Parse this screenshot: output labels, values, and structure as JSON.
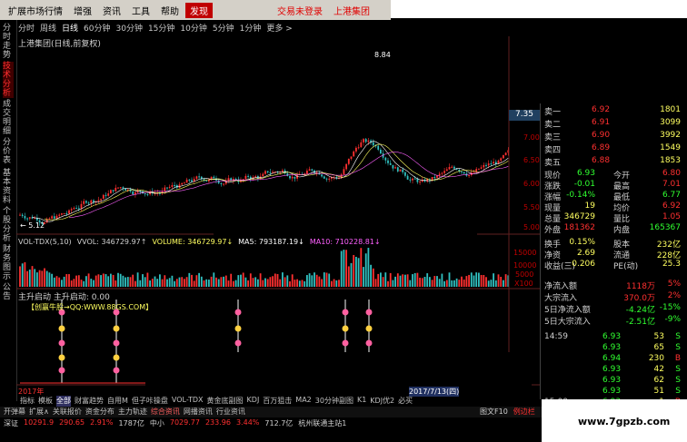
{
  "menubar": {
    "items": [
      "扩展市场行情",
      "增强",
      "资讯",
      "工具",
      "帮助"
    ],
    "active_item": "发现",
    "trade_status": "交易未登录",
    "stock_code_link": "上港集团"
  },
  "periods": [
    "分时",
    "周线",
    "日线",
    "60分钟",
    "30分钟",
    "15分钟",
    "10分钟",
    "5分钟",
    "1分钟",
    "更多 >"
  ],
  "selected_period": "日线",
  "chart_title": "上港集团(日线,前复权)",
  "left_tabs": [
    {
      "label": "分时走势",
      "active": false
    },
    {
      "label": "技术分析",
      "active": true
    },
    {
      "label": "成交明细",
      "active": false
    },
    {
      "label": "分价表",
      "active": false
    },
    {
      "label": "基本资料",
      "active": false
    },
    {
      "label": "个股分析",
      "active": false
    },
    {
      "label": "财务图示",
      "active": false
    },
    {
      "label": "公告",
      "active": false
    }
  ],
  "price_axis": {
    "labels": [
      "8.84",
      "7.00",
      "6.50",
      "6.00",
      "5.50",
      "5.00"
    ],
    "current_price_badge": "7.35",
    "low_marker": "← 5.12",
    "high_marker": "8.84"
  },
  "volume_header": {
    "name": "VOL-TDX(5,10)",
    "vvol": "VVOL: 346729.97↑",
    "volume": "VOLUME: 346729.97↓",
    "ma5": "MA5: 793187.19↓",
    "ma10": "MA10: 710228.81↓"
  },
  "volume_axis": [
    "15000",
    "10000",
    "5000",
    "X100"
  ],
  "indicator_header": "主升启动  主升启动: 0.00",
  "indicator_watermark": "【创赢牛股→QQ:WWW.88GS.COM】",
  "date_label": "2017年",
  "date_label_right": "2017/7/13(四)",
  "bottom_tabs": [
    "指标",
    "模板",
    "全部",
    "财富趋势",
    "自用M",
    "但子咔操盘",
    "VOL-TDX",
    "黄金底副图",
    "KDJ",
    "百万狙击",
    "MA2",
    "30分钟副图",
    "K1",
    "KDJ优2",
    "必买"
  ],
  "selected_bottom_tab": "全部",
  "bottom_tabs2": [
    "开弹幕",
    "扩展∧",
    "关联报价",
    "资金分布",
    "主力轨迹",
    "综合资讯",
    "网播资讯",
    "行业资讯"
  ],
  "selected_bottom_tab2": "综合资讯",
  "status": {
    "sh_label": "深证",
    "sh_value": "10291.9",
    "sh_change": "290.65",
    "sh_pct": "2.91%",
    "sh_amount": "1787亿",
    "mid_label": "中小",
    "mid_value": "7029.77",
    "mid_change": "233.96",
    "mid_pct": "3.44%",
    "mid_amount": "712.7亿",
    "network": "杭州联通主站1"
  },
  "right_panel_tabs": [
    "图文F10",
    "例边栏"
  ],
  "order_book": {
    "asks": [
      {
        "label": "卖一",
        "price": "6.92",
        "vol": "1801"
      },
      {
        "label": "卖二",
        "price": "6.91",
        "vol": "3099"
      },
      {
        "label": "卖三",
        "price": "6.90",
        "vol": "3992"
      },
      {
        "label": "卖四",
        "price": "6.89",
        "vol": "1549"
      },
      {
        "label": "卖五",
        "price": "6.88",
        "vol": "1853"
      }
    ]
  },
  "quote": {
    "now_label": "现价",
    "now": "6.93",
    "open_label": "今开",
    "open": "6.80",
    "chg_label": "涨跌",
    "chg": "-0.01",
    "high_label": "最高",
    "high": "7.01",
    "pct_label": "涨幅",
    "pct": "-0.14%",
    "low_label": "最低",
    "low": "6.77",
    "vol_now_label": "现量",
    "vol_now": "19",
    "avg_label": "均价",
    "avg": "6.92",
    "total_label": "总量",
    "total": "346729",
    "ratio_label": "量比",
    "ratio": "1.05",
    "out_label": "外盘",
    "out": "181362",
    "in_label": "内盘",
    "in": "165367",
    "turnover_label": "换手",
    "turnover": "0.15%",
    "equity_label": "股本",
    "equity": "232亿",
    "netasset_label": "净资",
    "netasset": "2.69",
    "float_label": "流通",
    "float": "228亿",
    "eps_label": "收益(三)",
    "eps": "0.206",
    "pe_label": "PE(动)",
    "pe": "25.3"
  },
  "flows": [
    {
      "label": "净流入额",
      "value": "1118万",
      "pct": "5%",
      "color": "#ff3030"
    },
    {
      "label": "大宗流入",
      "value": "370.0万",
      "pct": "2%",
      "color": "#ff3030"
    },
    {
      "label": "5日净流入额",
      "value": "-4.24亿",
      "pct": "-15%",
      "color": "#30ff30"
    },
    {
      "label": "5日大宗流入",
      "value": "-2.51亿",
      "pct": "-9%",
      "color": "#30ff30"
    }
  ],
  "ticks": [
    {
      "time": "14:59",
      "price": "6.93",
      "vol": "53",
      "side": "S"
    },
    {
      "time": "",
      "price": "6.93",
      "vol": "65",
      "side": "S"
    },
    {
      "time": "",
      "price": "6.94",
      "vol": "230",
      "side": "B"
    },
    {
      "time": "",
      "price": "6.93",
      "vol": "42",
      "side": "S"
    },
    {
      "time": "",
      "price": "6.93",
      "vol": "62",
      "side": "S"
    },
    {
      "time": "",
      "price": "6.93",
      "vol": "51",
      "side": "S"
    },
    {
      "time": "15:00",
      "price": "6.93",
      "vol": "1",
      "side": "B"
    }
  ],
  "site_watermark": "www.7gpzb.com",
  "colors": {
    "up": "#ff3030",
    "down": "#30c0c0",
    "accent_red": "#c00000",
    "text_yellow": "#ffff60"
  }
}
